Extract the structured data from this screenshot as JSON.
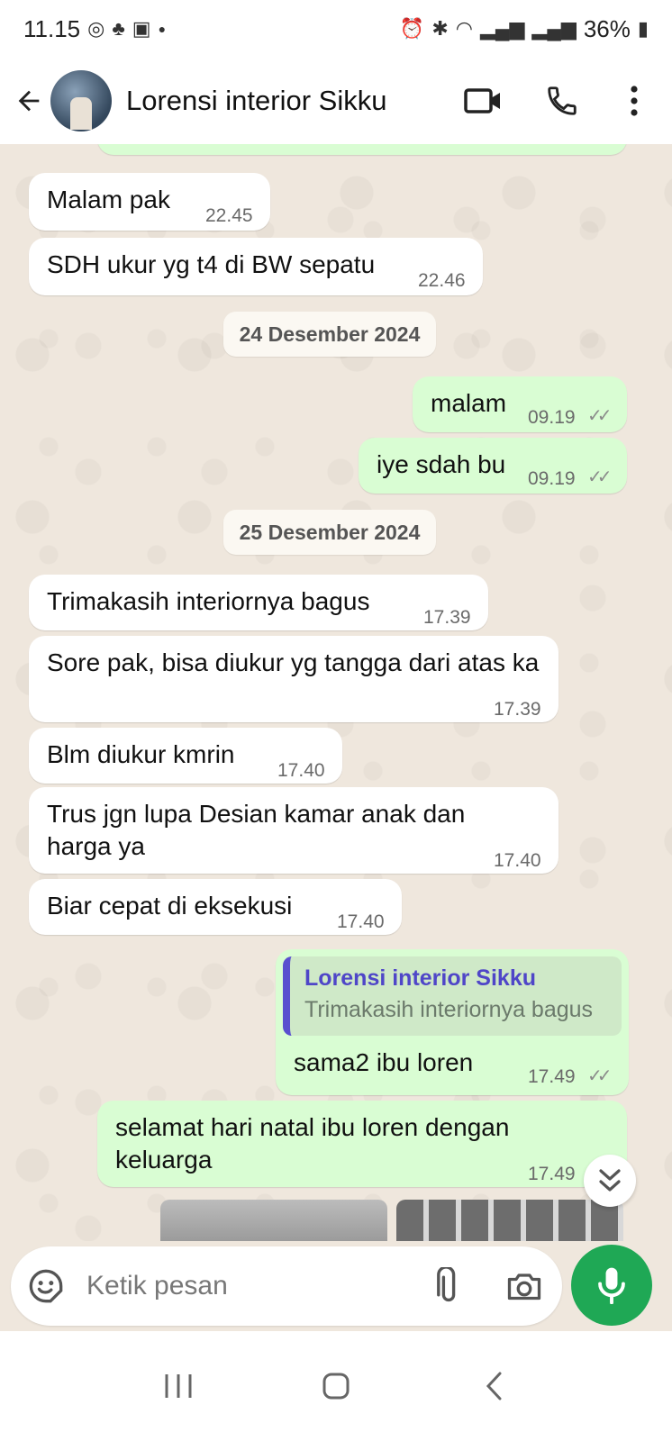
{
  "status_bar": {
    "time": "11.15",
    "battery": "36%"
  },
  "header": {
    "contact_name": "Lorensi interior Sikku"
  },
  "messages": [
    {
      "type": "date",
      "text": "24 Desember 2024"
    },
    {
      "type": "date",
      "text": "25 Desember 2024"
    }
  ],
  "msg": {
    "m1": {
      "text": "Malam pak",
      "time": "22.45"
    },
    "m2": {
      "text": "SDH ukur yg t4 di BW sepatu",
      "time": "22.46"
    },
    "d1": "24 Desember 2024",
    "m3": {
      "text": "malam",
      "time": "09.19"
    },
    "m4": {
      "text": "iye sdah bu",
      "time": "09.19"
    },
    "d2": "25 Desember 2024",
    "m5": {
      "text": "Trimakasih interiornya bagus",
      "time": "17.39"
    },
    "m6": {
      "text": "Sore pak, bisa diukur yg tangga dari atas ka",
      "time": "17.39"
    },
    "m7": {
      "text": "Blm diukur kmrin",
      "time": "17.40"
    },
    "m8": {
      "text": "Trus jgn lupa Desian kamar anak dan harga ya",
      "time": "17.40"
    },
    "m9": {
      "text": "Biar cepat di eksekusi",
      "time": "17.40"
    },
    "m10": {
      "quote_name": "Lorensi interior Sikku",
      "quote_text": "Trimakasih interiornya bagus",
      "text": "sama2 ibu loren",
      "time": "17.49"
    },
    "m11": {
      "text": "selamat hari natal ibu loren dengan keluarga",
      "time": "17.49"
    }
  },
  "composer": {
    "placeholder": "Ketik pesan"
  },
  "colors": {
    "outgoing_bubble": "#d9fdd3",
    "incoming_bubble": "#ffffff",
    "chat_background": "#efe7dd",
    "mic_button": "#1fa855",
    "quote_accent": "#5a4fcf"
  },
  "icons": [
    "back-arrow-icon",
    "video-call-icon",
    "phone-icon",
    "more-vert-icon",
    "emoji-icon",
    "attach-icon",
    "camera-icon",
    "mic-icon",
    "scroll-down-icon",
    "recent-apps-icon",
    "home-icon",
    "nav-back-icon"
  ]
}
